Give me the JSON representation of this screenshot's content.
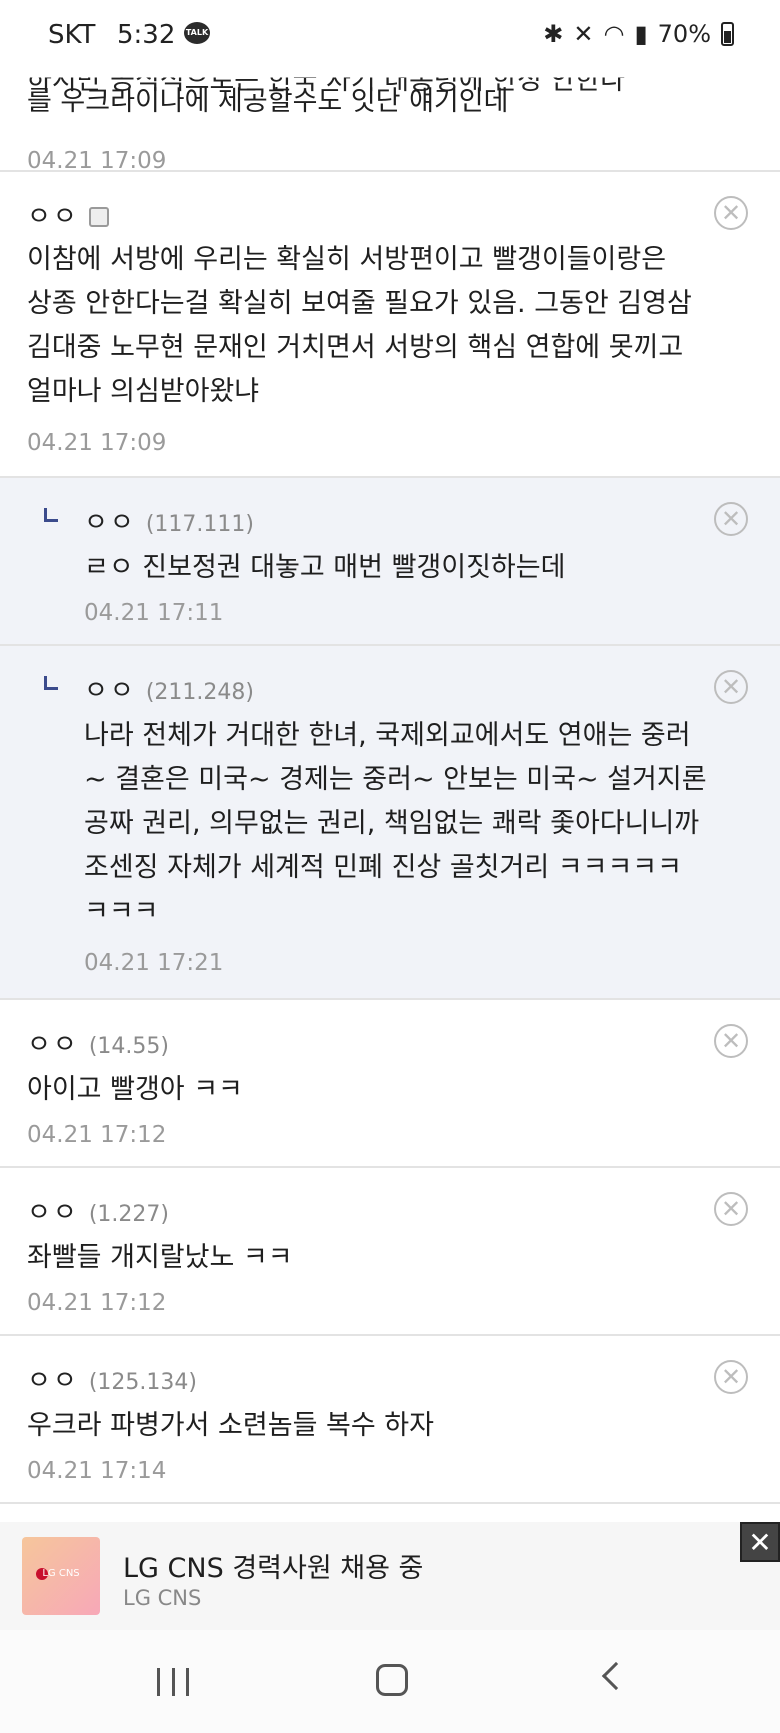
{
  "status_bar": {
    "carrier": "SKT",
    "time": "5:32",
    "talk_icon_label": "TALK",
    "battery": "70%"
  },
  "partial_comment": {
    "cut_line": "하지만 공식적으로는 한국 차기 대통령에 한정 안한다",
    "body": "를 우크라이나에 제공할수도 잇단 얘기인데",
    "time": "04.21 17:09"
  },
  "comments": [
    {
      "name": "ㅇㅇ",
      "ip": "",
      "is_reply": false,
      "lines": [
        "이참에 서방에 우리는 확실히 서방편이고 빨갱이들이랑은",
        "상종 안한다는걸 확실히 보여줄 필요가 있음. 그동안 김영삼",
        "김대중 노무현 문재인 거치면서 서방의 핵심 연합에 못끼고",
        "얼마나 의심받아왔냐"
      ],
      "time": "04.21 17:09"
    },
    {
      "name": "ㅇㅇ",
      "ip": "(117.111)",
      "is_reply": true,
      "lines": [
        "ㄹㅇ 진보정권 대놓고 매번 빨갱이짓하는데"
      ],
      "time": "04.21 17:11"
    },
    {
      "name": "ㅇㅇ",
      "ip": "(211.248)",
      "is_reply": true,
      "lines": [
        "나라 전체가 거대한 한녀, 국제외교에서도 연애는 중러",
        "~ 결혼은 미국~ 경제는 중러~ 안보는 미국~ 설거지론",
        "공짜 권리, 의무없는 권리, 책임없는 쾌락 좇아다니니까",
        "조센징 자체가 세계적 민폐 진상 골칫거리 ㅋㅋㅋㅋㅋ",
        "ㅋㅋㅋ"
      ],
      "time": "04.21 17:21"
    },
    {
      "name": "ㅇㅇ",
      "ip": "(14.55)",
      "is_reply": false,
      "lines": [
        "아이고 빨갱아 ㅋㅋ"
      ],
      "time": "04.21 17:12"
    },
    {
      "name": "ㅇㅇ",
      "ip": "(1.227)",
      "is_reply": false,
      "lines": [
        "좌빨들 개지랄났노 ㅋㅋ"
      ],
      "time": "04.21 17:12"
    },
    {
      "name": "ㅇㅇ",
      "ip": "(125.134)",
      "is_reply": false,
      "lines": [
        "우크라 파병가서 소련놈들 복수 하자"
      ],
      "time": "04.21 17:14"
    }
  ],
  "ad": {
    "logo_text": "LG CNS",
    "title": "LG CNS 경력사원 채용 중",
    "advertiser": "LG CNS",
    "close_glyph": "✕"
  },
  "delete_glyph": "✕"
}
